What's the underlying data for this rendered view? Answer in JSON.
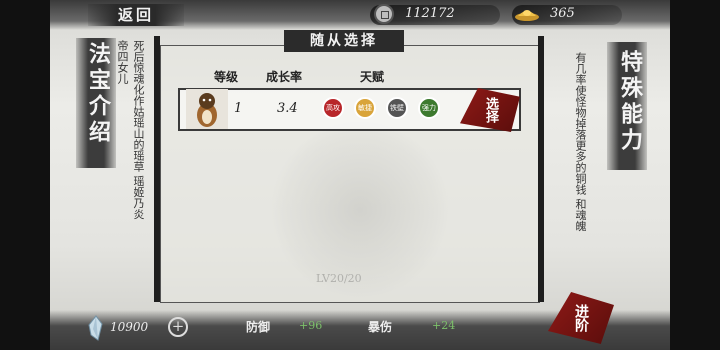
{
  "topbar": {
    "back_label": "返回",
    "copper_coins": "112172",
    "gold_ingots": "365"
  },
  "left_panel": {
    "title": "法宝介绍",
    "description": "死后惊魂化作姑瑶山的瑶草 瑶姬乃炎帝四女儿"
  },
  "right_panel": {
    "title": "特殊能力",
    "description": "有几率使怪物掉落更多的铜钱 和魂魄"
  },
  "main": {
    "title": "随从选择",
    "headers": {
      "level": "等级",
      "growth": "成长率",
      "talent": "天赋"
    },
    "row": {
      "level": "1",
      "growth": "3.4",
      "talents": [
        {
          "label": "高攻",
          "color": "#b8262a"
        },
        {
          "label": "敏捷",
          "color": "#d9a43a"
        },
        {
          "label": "铁壁",
          "color": "#555555"
        },
        {
          "label": "强力",
          "color": "#3d7a2f"
        }
      ],
      "select_label": "选择"
    },
    "level_faint": "LV20/20"
  },
  "bottombar": {
    "crystals": "10900",
    "plus_label": "+",
    "defense_label": "防御",
    "defense_val": "+96",
    "crit_label": "暴伤",
    "crit_val": "+24",
    "advance_label": "进阶"
  }
}
